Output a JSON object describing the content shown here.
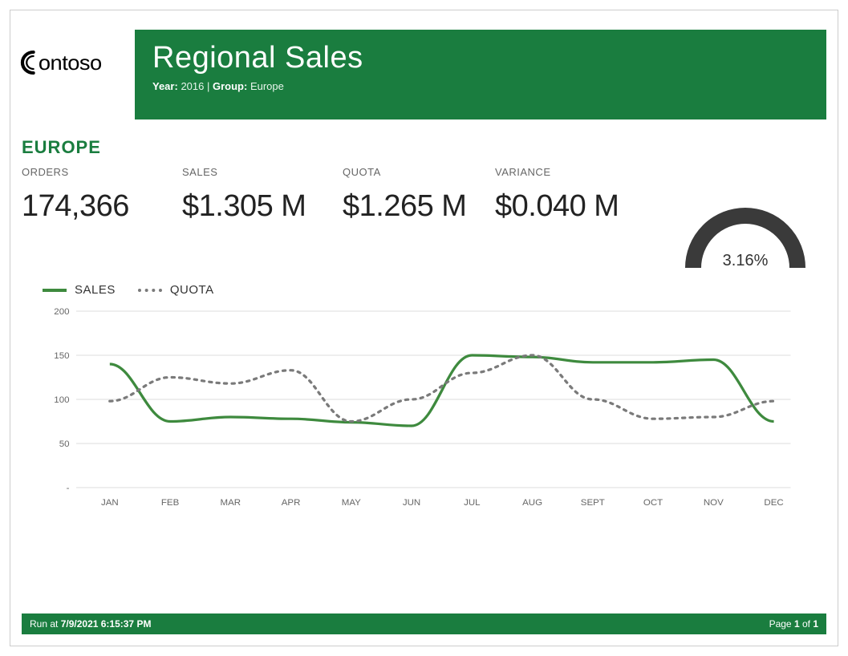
{
  "logo_text": "Contoso",
  "banner": {
    "title": "Regional Sales",
    "year_label": "Year:",
    "year_value": "2016",
    "sep": " | ",
    "group_label": "Group:",
    "group_value": "Europe"
  },
  "region_heading": "EUROPE",
  "kpis": {
    "orders_label": "ORDERS",
    "orders_value": "174,366",
    "sales_label": "SALES",
    "sales_value": "$1.305 M",
    "quota_label": "QUOTA",
    "quota_value": "$1.265 M",
    "variance_label": "VARIANCE",
    "variance_value": "$0.040 M"
  },
  "gauge": {
    "percent_label": "3.16%",
    "percent_value": 3.16
  },
  "legend": {
    "sales": "SALES",
    "quota": "QUOTA"
  },
  "footer": {
    "run_prefix": "Run at ",
    "run_time": "7/9/2021 6:15:37 PM",
    "page_prefix": "Page ",
    "page_num": "1",
    "page_of": " of ",
    "page_total": "1"
  },
  "chart_data": {
    "type": "line",
    "title": "",
    "xlabel": "",
    "ylabel": "",
    "ylim": [
      0,
      200
    ],
    "y_ticks": [
      0,
      50,
      100,
      150,
      200
    ],
    "y_tick_labels": [
      "-",
      "50",
      "100",
      "150",
      "200"
    ],
    "categories": [
      "JAN",
      "FEB",
      "MAR",
      "APR",
      "MAY",
      "JUN",
      "JUL",
      "AUG",
      "SEPT",
      "OCT",
      "NOV",
      "DEC"
    ],
    "series": [
      {
        "name": "SALES",
        "style": "solid",
        "color": "#3e8a3e",
        "values": [
          140,
          75,
          80,
          78,
          74,
          70,
          150,
          148,
          142,
          142,
          145,
          75
        ]
      },
      {
        "name": "QUOTA",
        "style": "dotted",
        "color": "#7a7a7a",
        "values": [
          98,
          125,
          118,
          133,
          75,
          100,
          130,
          150,
          100,
          78,
          80,
          98
        ]
      }
    ]
  }
}
